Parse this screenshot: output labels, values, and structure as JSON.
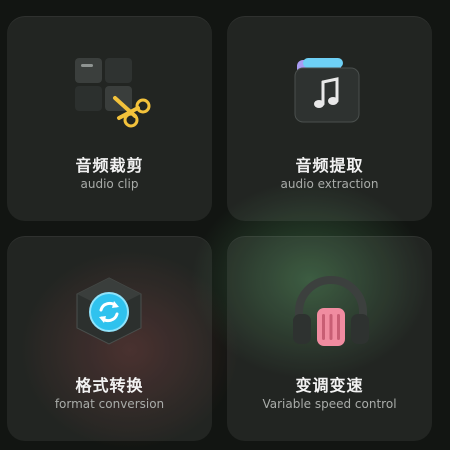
{
  "features": [
    {
      "title": "音频裁剪",
      "subtitle": "audio clip",
      "icon": "scissors-grid-icon"
    },
    {
      "title": "音频提取",
      "subtitle": "audio extraction",
      "icon": "music-folder-icon"
    },
    {
      "title": "格式转换",
      "subtitle": "format conversion",
      "icon": "convert-cube-icon"
    },
    {
      "title": "变调变速",
      "subtitle": "Variable speed control",
      "icon": "headphones-icon"
    }
  ],
  "colors": {
    "background": "#121512",
    "card": "#232623",
    "accent_yellow": "#f3c23b",
    "accent_blue": "#2fc2ee",
    "accent_pink": "#f08ca0",
    "accent_purple": "#9b8cf0"
  }
}
